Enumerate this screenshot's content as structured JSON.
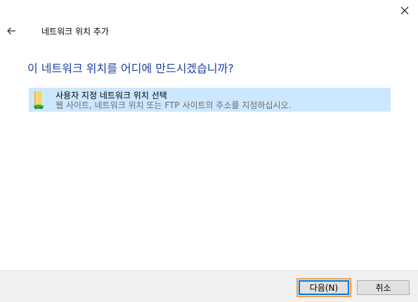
{
  "window": {
    "close_icon": "close-icon",
    "back_icon": "back-arrow-icon",
    "title": "네트워크 위치 추가"
  },
  "main": {
    "heading": "이 네트워크 위치를 어디에 만드시겠습니까?",
    "options": [
      {
        "icon": "network-folder-icon",
        "title": "사용자 지정 네트워크 위치 선택",
        "description": "웹 사이트, 네트워크 위치 또는 FTP 사이트의 주소를 지정하십시오.",
        "selected": true
      }
    ]
  },
  "footer": {
    "next_label": "다음(N)",
    "cancel_label": "취소"
  },
  "colors": {
    "heading": "#1e3ea0",
    "selection": "#cce8ff",
    "focus_outline": "#f0a04b"
  }
}
